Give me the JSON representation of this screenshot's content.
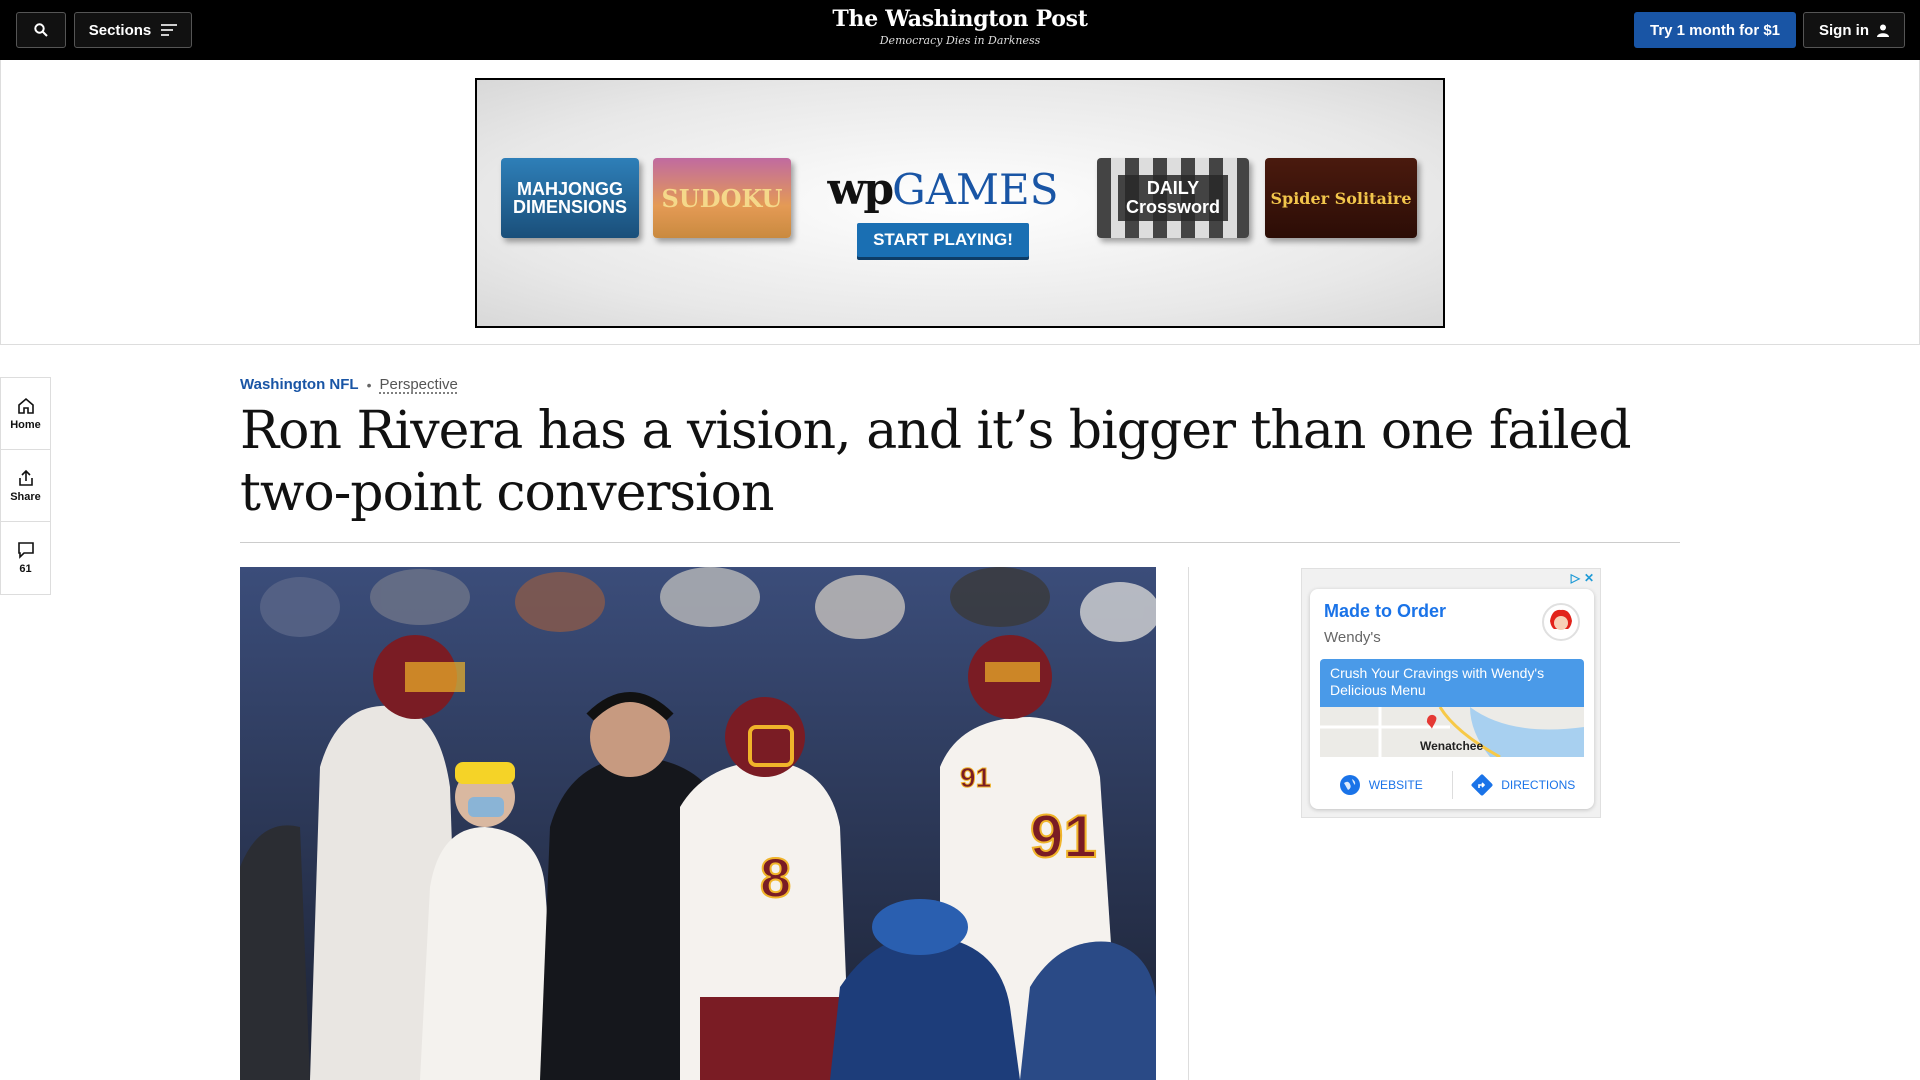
{
  "nav": {
    "sections_label": "Sections",
    "logo_title": "The Washington Post",
    "logo_tagline": "Democracy Dies in Darkness",
    "subscribe_label": "Try 1 month for $1",
    "signin_label": "Sign in"
  },
  "top_ad": {
    "mahjong": "MAHJONGG DIMENSIONS",
    "sudoku": "SUDOKU",
    "brand_prefix": "wp",
    "brand_suffix": "GAMES",
    "cta": "START PLAYING!",
    "crossword_line1": "DAILY",
    "crossword_line2": "Crossword",
    "spider": "Spider Solitaire"
  },
  "rail": {
    "home": "Home",
    "share": "Share",
    "comments": "61"
  },
  "article": {
    "section": "Washington NFL",
    "label": "Perspective",
    "headline": "Ron Rivera has a vision, and it’s bigger than one failed two-point conversion"
  },
  "side_ad": {
    "title": "Made to Order",
    "brand": "Wendy's",
    "banner": "Crush Your Cravings with Wendy's Delicious Menu",
    "city": "Wenatchee",
    "website": "WEBSITE",
    "directions": "DIRECTIONS"
  },
  "photo_jerseys": [
    "91",
    "8",
    "91"
  ],
  "colors": {
    "accent_blue": "#1955a5",
    "nav_bg": "#000000",
    "team_burgundy": "#7a1c24",
    "team_gold": "#f0b42a"
  }
}
